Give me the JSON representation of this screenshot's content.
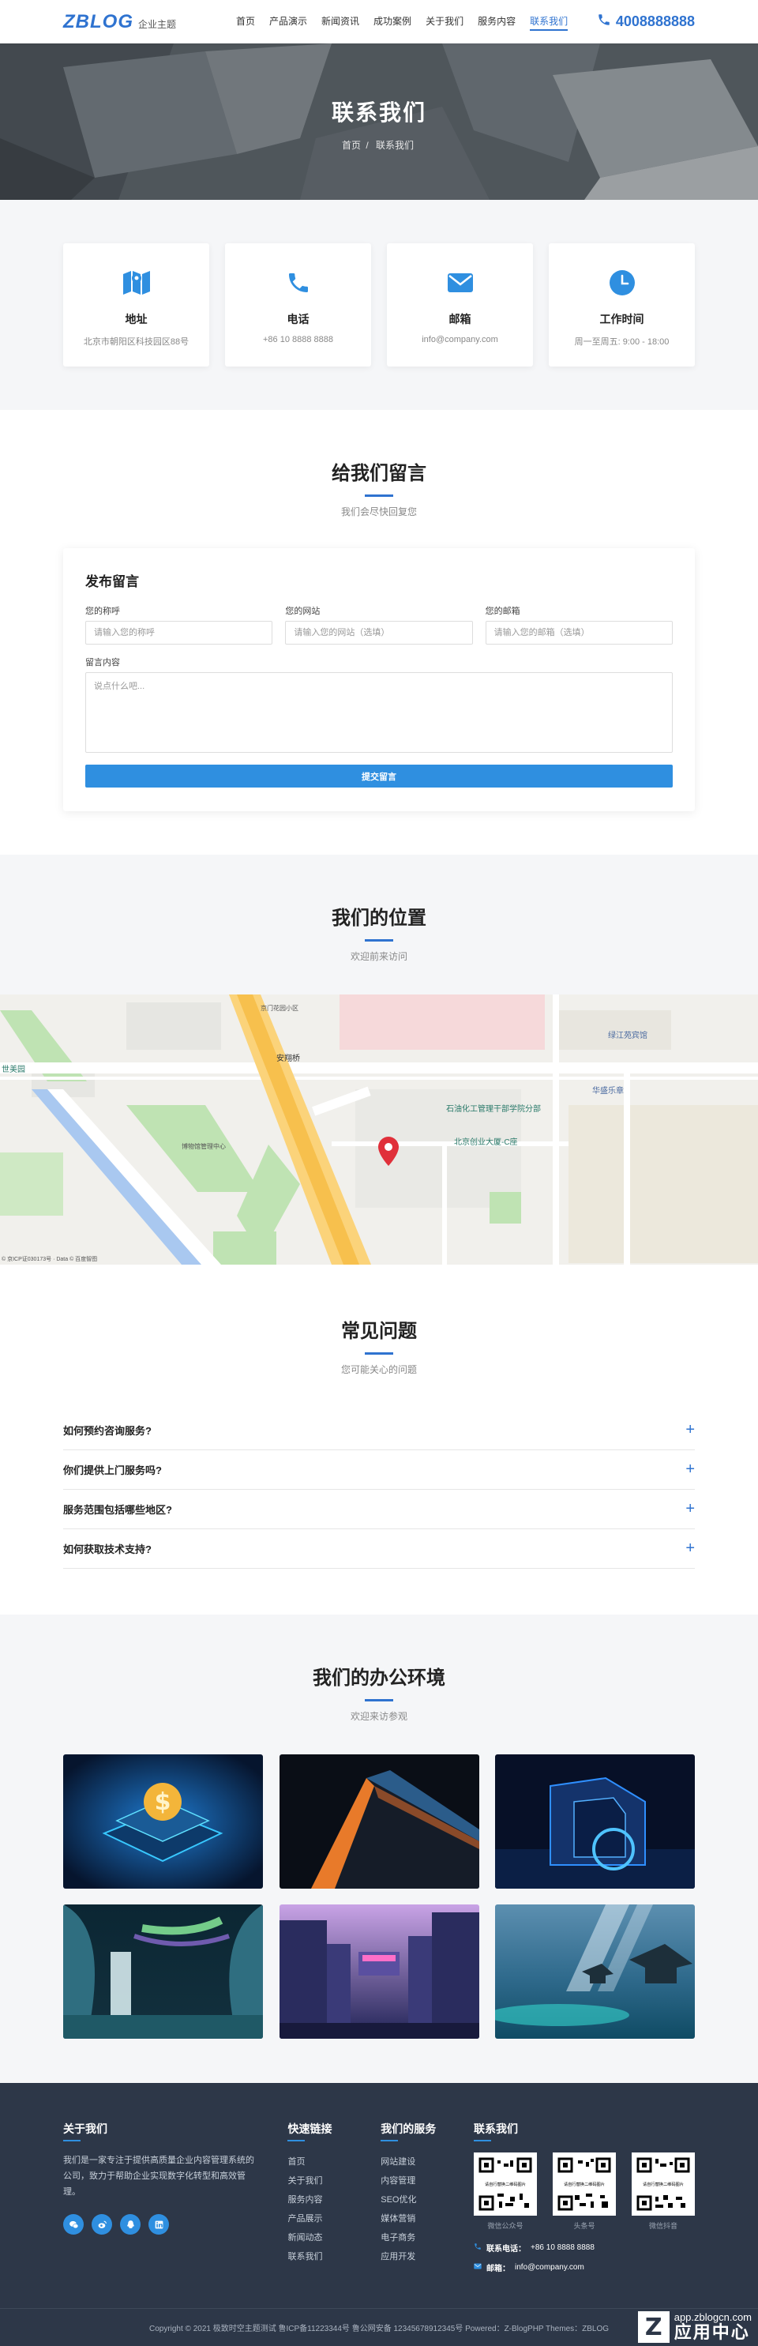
{
  "header": {
    "logo_main": "ZBLOG",
    "logo_sub": "企业主题",
    "nav": [
      "首页",
      "产品演示",
      "新闻资讯",
      "成功案例",
      "关于我们",
      "服务内容",
      "联系我们"
    ],
    "active_index": 6,
    "phone": "4008888888"
  },
  "banner": {
    "title": "联系我们",
    "breadcrumb_home": "首页",
    "breadcrumb_sep": "/",
    "breadcrumb_current": "联系我们"
  },
  "info_cards": [
    {
      "icon": "map-icon",
      "title": "地址",
      "text": "北京市朝阳区科技园区88号"
    },
    {
      "icon": "phone-icon",
      "title": "电话",
      "text": "+86 10 8888 8888"
    },
    {
      "icon": "mail-icon",
      "title": "邮箱",
      "text": "info@company.com"
    },
    {
      "icon": "clock-icon",
      "title": "工作时间",
      "text": "周一至周五: 9:00 - 18:00"
    }
  ],
  "message": {
    "title": "给我们留言",
    "subtitle": "我们会尽快回复您",
    "form_title": "发布留言",
    "name_label": "您的称呼",
    "name_placeholder": "请输入您的称呼",
    "site_label": "您的网站",
    "site_placeholder": "请输入您的网站（选填）",
    "email_label": "您的邮箱",
    "email_placeholder": "请输入您的邮箱（选填）",
    "content_label": "留言内容",
    "content_placeholder": "说点什么吧...",
    "submit_label": "提交留言"
  },
  "location": {
    "title": "我们的位置",
    "subtitle": "欢迎前来访问",
    "map_labels": [
      "安翔桥",
      "石油化工管理干部学院分部",
      "北京创业大厦-C座",
      "华盛乐章",
      "绿江苑宾馆",
      "世美园",
      "博物馆管理中心",
      "京门花园小区"
    ],
    "map_copyright": "© 京ICP证030173号 · Data © 百度智图"
  },
  "faq": {
    "title": "常见问题",
    "subtitle": "您可能关心的问题",
    "items": [
      "如何预约咨询服务?",
      "你们提供上门服务吗?",
      "服务范围包括哪些地区?",
      "如何获取技术支持?"
    ],
    "toggle": "+"
  },
  "office": {
    "title": "我们的办公环境",
    "subtitle": "欢迎来访参观"
  },
  "footer": {
    "about_title": "关于我们",
    "about_text": "我们是一家专注于提供高质量企业内容管理系统的公司，致力于帮助企业实现数字化转型和高效管理。",
    "links_title": "快速链接",
    "links": [
      "首页",
      "关于我们",
      "服务内容",
      "产品展示",
      "新闻动态",
      "联系我们"
    ],
    "services_title": "我们的服务",
    "services": [
      "网站建设",
      "内容管理",
      "SEO优化",
      "媒体营销",
      "电子商务",
      "应用开发"
    ],
    "contact_title": "联系我们",
    "qr_captions": [
      "微信公众号",
      "头条号",
      "微信抖音"
    ],
    "qr_inner_text": "请自行替换二维码图片",
    "phone_label": "联系电话：",
    "phone_value": "+86 10 8888 8888",
    "email_label": "邮箱：",
    "email_value": "info@company.com",
    "copyright": "Copyright © 2021 极致时空主题测试  鲁ICP备11223344号  鲁公网安备 1234567891234​5号  Powered：Z-BlogPHP  Themes：ZBLOG",
    "watermark_url": "app.zblogcn.com",
    "watermark_name": "应用中心",
    "watermark_logo": "Z"
  },
  "colors": {
    "accent": "#2f73d0",
    "button": "#2f8fe0",
    "footer_bg": "#2d3748",
    "section_bg": "#f5f6f8"
  }
}
